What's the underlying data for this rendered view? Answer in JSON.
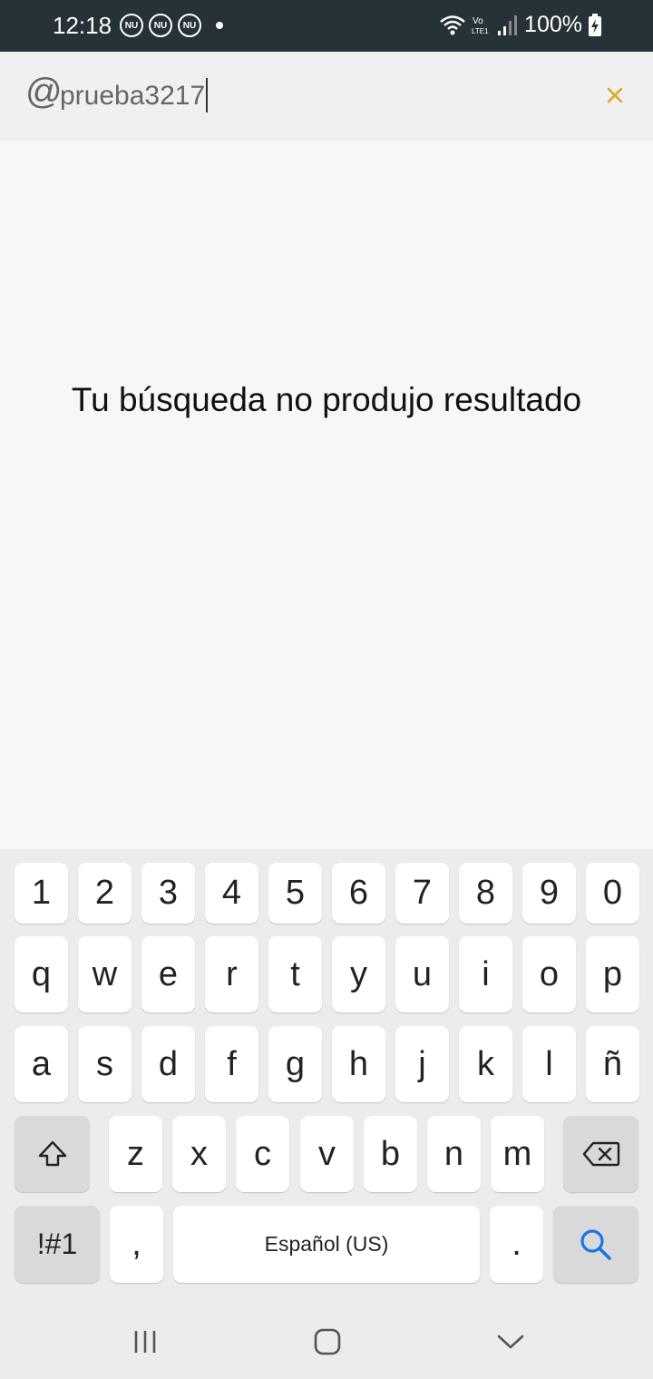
{
  "status_bar": {
    "time": "12:18",
    "notification_icons": [
      "NU",
      "NU",
      "NU"
    ],
    "battery": "100%",
    "network_label": "Vo LTE1"
  },
  "search": {
    "prefix": "@",
    "value": "prueba3217",
    "close_icon": "close-icon",
    "accent_color": "#e0a526"
  },
  "content": {
    "empty_message": "Tu búsqueda no produjo resultado"
  },
  "keyboard": {
    "row_numbers": [
      "1",
      "2",
      "3",
      "4",
      "5",
      "6",
      "7",
      "8",
      "9",
      "0"
    ],
    "row_1": [
      "q",
      "w",
      "e",
      "r",
      "t",
      "y",
      "u",
      "i",
      "o",
      "p"
    ],
    "row_2": [
      "a",
      "s",
      "d",
      "f",
      "g",
      "h",
      "j",
      "k",
      "l",
      "ñ"
    ],
    "row_3": [
      "z",
      "x",
      "c",
      "v",
      "b",
      "n",
      "m"
    ],
    "symbols_key": "!#1",
    "comma_key": ",",
    "space_label": "Español (US)",
    "period_key": ".",
    "search_key_color": "#1a73e8"
  },
  "nav": {
    "recents": "recents-icon",
    "home": "home-icon",
    "back": "back-icon"
  }
}
